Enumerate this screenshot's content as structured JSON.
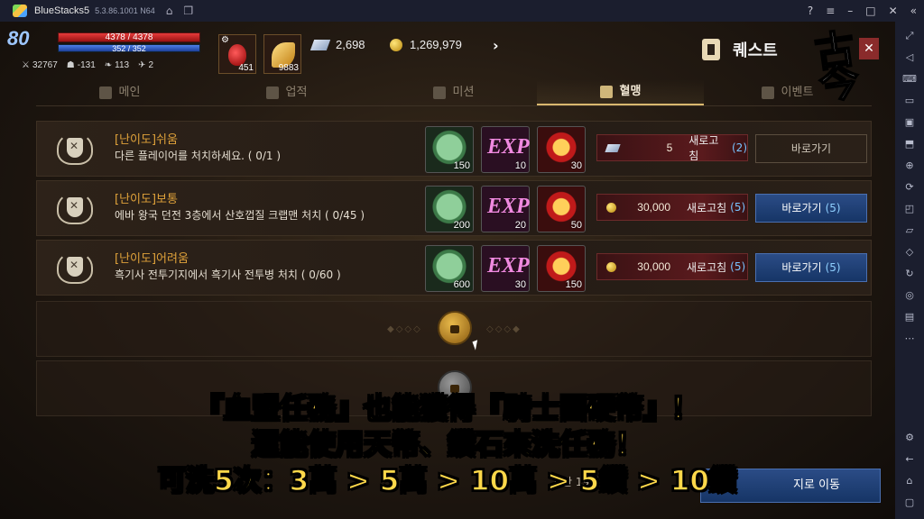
{
  "window": {
    "app_name": "BlueStacks5",
    "version": "5.3.86.1001 N64"
  },
  "hud": {
    "level": "80",
    "hp": "4378 / 4378",
    "mp": "352 / 352",
    "stats": [
      "32767",
      "-131",
      "113",
      "2"
    ],
    "items": [
      {
        "icon": "potion-icon",
        "count": "451"
      },
      {
        "icon": "feather-icon",
        "count": "9883"
      }
    ],
    "gems": "2,698",
    "gold": "1,269,979"
  },
  "panel": {
    "title": "퀘스트",
    "tabs": [
      {
        "label": "메인",
        "active": false
      },
      {
        "label": "업적",
        "active": false
      },
      {
        "label": "미션",
        "active": false
      },
      {
        "label": "혈맹",
        "active": true
      },
      {
        "label": "이벤트",
        "active": false
      }
    ]
  },
  "quests": [
    {
      "difficulty": "[난이도]쉬움",
      "description": "다른 플레이어를 처치하세요. ( 0/1 )",
      "rewards": [
        "150",
        "10",
        "30"
      ],
      "cost_type": "gem",
      "cost": "5",
      "refresh_label": "새로고침",
      "refresh_count": "(2)",
      "go_label": "바로가기",
      "go_count": "",
      "go_enabled": false
    },
    {
      "difficulty": "[난이도]보통",
      "description": "에바 왕국 던전 3층에서 산호껍질 크랩맨 처치 ( 0/45 )",
      "rewards": [
        "200",
        "20",
        "50"
      ],
      "cost_type": "gold",
      "cost": "30,000",
      "refresh_label": "새로고침",
      "refresh_count": "(5)",
      "go_label": "바로가기",
      "go_count": "(5)",
      "go_enabled": true
    },
    {
      "difficulty": "[난이도]어려움",
      "description": "흑기사 전투기지에서 흑기사 전투병 처치 ( 0/60 )",
      "rewards": [
        "600",
        "30",
        "150"
      ],
      "cost_type": "gold",
      "cost": "30,000",
      "refresh_label": "새로고침",
      "refresh_count": "(5)",
      "go_label": "바로가기",
      "go_count": "(5)",
      "go_enabled": true
    }
  ],
  "bottom": {
    "timer_text": "시간 19시간",
    "timer_suffix": "초",
    "move_button": "지로 이동"
  },
  "watermark": "古今",
  "subtitles": [
    "『血盟任務』也能獲得『騎士團硬幣』！",
    "還能使用天幣、鑽石來洗任務！",
    "可洗5次：3萬 > 5萬 > 10萬 > 5鑽 > 10鑽"
  ]
}
